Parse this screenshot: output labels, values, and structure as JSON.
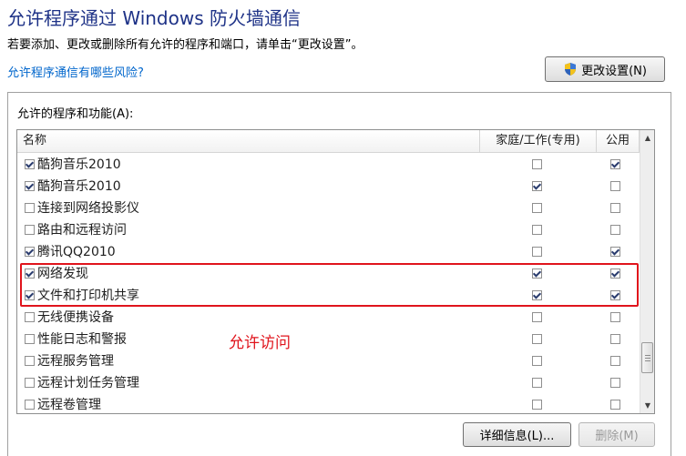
{
  "title": "允许程序通过 Windows 防火墙通信",
  "description": "若要添加、更改或删除所有允许的程序和端口，请单击“更改设置”。",
  "risk_link": "允许程序通信有哪些风险?",
  "change_settings_button": "更改设置(N)",
  "group_label": "允许的程序和功能(A):",
  "columns": {
    "name": "名称",
    "home_work": "家庭/工作(专用)",
    "public": "公用"
  },
  "rows": [
    {
      "name": "酷狗音乐2010",
      "enabled": true,
      "home": false,
      "public": true
    },
    {
      "name": "酷狗音乐2010",
      "enabled": true,
      "home": true,
      "public": false
    },
    {
      "name": "连接到网络投影仪",
      "enabled": false,
      "home": false,
      "public": false
    },
    {
      "name": "路由和远程访问",
      "enabled": false,
      "home": false,
      "public": false
    },
    {
      "name": "腾讯QQ2010",
      "enabled": true,
      "home": false,
      "public": true
    },
    {
      "name": "网络发现",
      "enabled": true,
      "home": true,
      "public": true
    },
    {
      "name": "文件和打印机共享",
      "enabled": true,
      "home": true,
      "public": true
    },
    {
      "name": "无线便携设备",
      "enabled": false,
      "home": false,
      "public": false
    },
    {
      "name": "性能日志和警报",
      "enabled": false,
      "home": false,
      "public": false
    },
    {
      "name": "远程服务管理",
      "enabled": false,
      "home": false,
      "public": false
    },
    {
      "name": "远程计划任务管理",
      "enabled": false,
      "home": false,
      "public": false
    },
    {
      "name": "远程卷管理",
      "enabled": false,
      "home": false,
      "public": false
    }
  ],
  "annotation": "允许访问",
  "details_button": "详细信息(L)...",
  "delete_button": "删除(M)",
  "colors": {
    "title": "#1e3287",
    "link": "#0066cc",
    "highlight": "#e0141c"
  },
  "icons": {
    "change_settings": "uac-shield-icon",
    "scroll_up": "scroll-up-arrow-icon",
    "scroll_down": "scroll-down-arrow-icon"
  }
}
